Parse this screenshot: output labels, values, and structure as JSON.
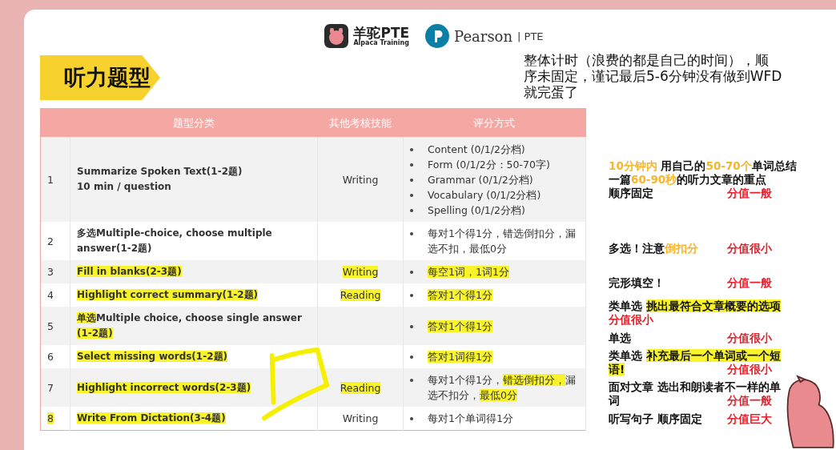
{
  "header": {
    "brand_name": "羊驼PTE",
    "brand_tagline": "Alpaca Training",
    "partner_name": "Pearson",
    "partner_product": "| PTE"
  },
  "title": "听力题型",
  "intro_lines": [
    "整体计时（浪费的都是自己的时间），顺",
    "序未固定，谨记最后5-6分钟没有做到WFD",
    "就完蛋了"
  ],
  "table": {
    "columns": [
      "",
      "题型分类",
      "其他考核技能",
      "评分方式"
    ],
    "rows": [
      {
        "number": {
          "text": "1",
          "highlight": false
        },
        "name": [
          {
            "text": "Summarize Spoken Text(1-2题)",
            "highlight": false
          },
          {
            "text": "10 min / question",
            "highlight": false,
            "kind": "newline"
          }
        ],
        "skill": {
          "text": "Writing",
          "highlight": false
        },
        "scoring": [
          [
            {
              "text": "Content (0/1/2分档)",
              "highlight": false
            }
          ],
          [
            {
              "text": "Form (0/1/2分：50-70字)",
              "highlight": false
            }
          ],
          [
            {
              "text": "Grammar (0/1/2分档)",
              "highlight": false
            }
          ],
          [
            {
              "text": "Vocabulary (0/1/2分档)",
              "highlight": false
            }
          ],
          [
            {
              "text": "Spelling (0/1/2分档)",
              "highlight": false
            }
          ]
        ]
      },
      {
        "number": {
          "text": "2",
          "highlight": false
        },
        "name": [
          {
            "text": "多选Multiple-choice, choose multiple answer(1-2题)",
            "highlight": false
          }
        ],
        "scoring": [
          [
            {
              "text": "每对1个得1分，错选倒扣分，漏选不扣，最低0分",
              "highlight": false
            }
          ]
        ]
      },
      {
        "number": {
          "text": "3",
          "highlight": false
        },
        "name": [
          {
            "text": "Fill in blanks(2-3题)",
            "highlight": true
          }
        ],
        "skill": {
          "text": "Writing",
          "highlight": true
        },
        "scoring": [
          [
            {
              "text": "每空1词，1词1分",
              "highlight": true
            }
          ]
        ]
      },
      {
        "number": {
          "text": "4",
          "highlight": false
        },
        "name": [
          {
            "text": "Highlight correct summary(1-2题)",
            "highlight": true
          }
        ],
        "skill": {
          "text": "Reading",
          "highlight": true
        },
        "scoring": [
          [
            {
              "text": "答对1个得1分",
              "highlight": true
            }
          ]
        ]
      },
      {
        "number": {
          "text": "5",
          "highlight": false
        },
        "name": [
          {
            "text": "单选",
            "highlight": true
          },
          {
            "text": "Multiple choice, choose single answer ",
            "highlight": false
          },
          {
            "text": "(1-2题)",
            "highlight": true
          }
        ],
        "scoring": [
          [
            {
              "text": "答对1个得1分",
              "highlight": true
            }
          ]
        ]
      },
      {
        "number": {
          "text": "6",
          "highlight": false
        },
        "name": [
          {
            "text": "Select missing words(1-2题)",
            "highlight": true
          }
        ],
        "scoring": [
          [
            {
              "text": "答对1词得1分",
              "highlight": true
            }
          ]
        ]
      },
      {
        "number": {
          "text": "7",
          "highlight": false
        },
        "name": [
          {
            "text": "Highlight incorrect words(2-3题)",
            "highlight": true
          }
        ],
        "skill": {
          "text": "Reading",
          "highlight": true
        },
        "scoring": [
          [
            {
              "text": "每对1个得1分，",
              "highlight": false
            },
            {
              "text": "错选倒扣分，",
              "highlight": true
            },
            {
              "text": "漏选不扣分，",
              "highlight": false
            },
            {
              "text": "最低0分",
              "highlight": true
            }
          ]
        ]
      },
      {
        "number": {
          "text": "8",
          "highlight": true
        },
        "name": [
          {
            "text": "Write From Dictation(3-4题)",
            "highlight": true
          }
        ],
        "skill": {
          "text": "Writing",
          "highlight": false
        },
        "scoring": [
          [
            {
              "text": "每对1个单词得1分",
              "highlight": false
            }
          ]
        ]
      }
    ]
  },
  "notes": [
    {
      "lines": [
        {
          "parts": [
            {
              "text": "10分钟内",
              "kind": "accent"
            },
            {
              "text": " 用自己的",
              "kind": "plain"
            },
            {
              "text": "50-70个",
              "kind": "accent"
            },
            {
              "text": "单词总结",
              "kind": "plain"
            }
          ]
        },
        {
          "parts": [
            {
              "text": "一篇",
              "kind": "plain"
            },
            {
              "text": "60-90秒",
              "kind": "accent"
            },
            {
              "text": "的听力文章的重点",
              "kind": "plain"
            }
          ]
        },
        {
          "parts": [
            {
              "text": "顺序固定",
              "kind": "plain"
            }
          ],
          "score": "分值一般"
        }
      ]
    },
    {
      "lines": [
        {
          "parts": [
            {
              "text": "多选！注意",
              "kind": "plain"
            },
            {
              "text": "倒扣分",
              "kind": "accent"
            }
          ],
          "score": "分值很小"
        }
      ]
    },
    {
      "lines": [
        {
          "parts": [
            {
              "text": "完形填空！",
              "kind": "plain"
            }
          ],
          "score": "分值一般"
        }
      ]
    },
    {
      "lines": [
        {
          "parts": [
            {
              "text": "类单选 ",
              "kind": "plain"
            },
            {
              "text": "挑出最符合文章概要的选项",
              "kind": "marked"
            }
          ]
        },
        {
          "parts": [
            {
              "text": "分值很小",
              "kind": "warning"
            }
          ]
        }
      ]
    },
    {
      "lines": [
        {
          "parts": [
            {
              "text": "单选",
              "kind": "plain"
            }
          ],
          "score": "分值很小"
        }
      ]
    },
    {
      "lines": [
        {
          "parts": [
            {
              "text": "类单选 ",
              "kind": "plain"
            },
            {
              "text": "补充最后一个单词或一个短",
              "kind": "marked"
            }
          ]
        },
        {
          "parts": [
            {
              "text": "语!",
              "kind": "marked"
            }
          ],
          "score": "分值很小"
        }
      ]
    },
    {
      "lines": [
        {
          "parts": [
            {
              "text": "面对文章 选出和朗读者不一样的单",
              "kind": "plain"
            }
          ]
        },
        {
          "parts": [
            {
              "text": "词",
              "kind": "plain"
            }
          ],
          "score": "分值一般"
        }
      ]
    },
    {
      "lines": [
        {
          "parts": [
            {
              "text": "听写句子  顺序固定",
              "kind": "plain"
            }
          ],
          "score": "分值巨大"
        }
      ]
    }
  ]
}
